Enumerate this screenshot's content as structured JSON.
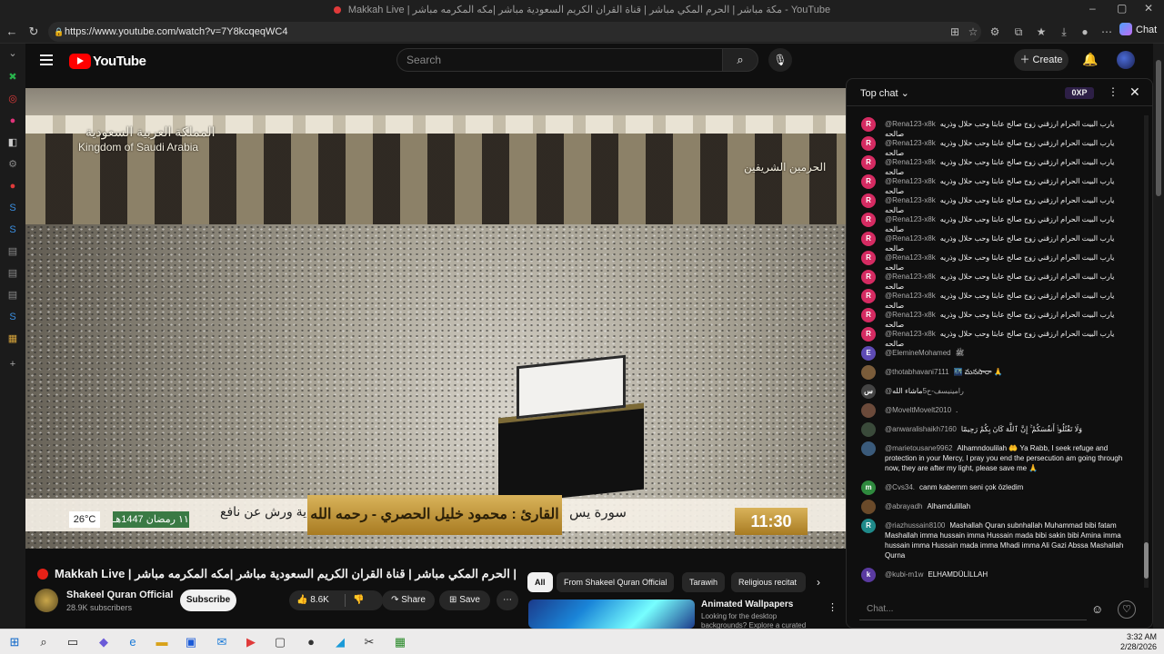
{
  "browser": {
    "window_title": "Makkah Live | مكة مباشر | الحرم المكي مباشر | قناة القران الكريم السعودية مباشر |مكه المكرمه مباشر - YouTube",
    "url": "https://www.youtube.com/watch?v=7Y8kcqeqWC4",
    "chat_label": "Chat"
  },
  "header": {
    "logo_text": "YouTube",
    "search_placeholder": "Search",
    "create_label": "Create"
  },
  "video": {
    "watermark_ar": "المملكة العربية السعودية",
    "watermark_en": "Kingdom of Saudi Arabia",
    "watermark_right": "الحرمين الشريفين",
    "temperature": "26°C",
    "hijri_date": "١١ رمضان 1447هـ",
    "riwaya": "رواية ورش عن نافع",
    "reciter": "القارئ : محمود خليل الحصري - رحمه الله",
    "surah": "سورة يس",
    "clock": "11:30"
  },
  "below": {
    "title": "Makkah Live | مكة مباشر | الحرم المكي مباشر | قناة القران الكريم السعودية مباشر |مكه المكرمه مباشر",
    "channel_name": "Shakeel Quran Official",
    "subscribers": "28.9K subscribers",
    "subscribe_label": "Subscribe",
    "likes": "8.6K",
    "share_label": "Share",
    "save_label": "Save",
    "chips": [
      "All",
      "From Shakeel Quran Official",
      "Tarawih",
      "Religious recitat"
    ],
    "rec_title": "Animated Wallpapers",
    "rec_sub": "Looking for the desktop backgrounds? Explore a curated"
  },
  "chat": {
    "header": "Top chat",
    "xp": "0XP",
    "input_placeholder": "Chat...",
    "messages": [
      {
        "initial": "R",
        "author": "@Rena123-x8k",
        "text": "يارب البيت الحرام ارزقني زوج صالح عابثا وحب حلال وذريه صالحه",
        "color": "#d52b62"
      },
      {
        "initial": "R",
        "author": "@Rena123-x8k",
        "text": "يارب البيت الحرام ارزقني زوج صالح عابثا وحب حلال وذريه صالحه",
        "color": "#d52b62"
      },
      {
        "initial": "R",
        "author": "@Rena123-x8k",
        "text": "يارب البيت الحرام ارزقني زوج صالح عابثا وحب حلال وذريه صالحه",
        "color": "#d52b62"
      },
      {
        "initial": "R",
        "author": "@Rena123-x8k",
        "text": "يارب البيت الحرام ارزقني زوج صالح عابثا وحب حلال وذريه صالحه",
        "color": "#d52b62"
      },
      {
        "initial": "R",
        "author": "@Rena123-x8k",
        "text": "يارب البيت الحرام ارزقني زوج صالح عابثا وحب حلال وذريه صالحه",
        "color": "#d52b62"
      },
      {
        "initial": "R",
        "author": "@Rena123-x8k",
        "text": "يارب البيت الحرام ارزقني زوج صالح عابثا وحب حلال وذريه صالحه",
        "color": "#d52b62"
      },
      {
        "initial": "R",
        "author": "@Rena123-x8k",
        "text": "يارب البيت الحرام ارزقني زوج صالح عابثا وحب حلال وذريه صالحه",
        "color": "#d52b62"
      },
      {
        "initial": "R",
        "author": "@Rena123-x8k",
        "text": "يارب البيت الحرام ارزقني زوج صالح عابثا وحب حلال وذريه صالحه",
        "color": "#d52b62"
      },
      {
        "initial": "R",
        "author": "@Rena123-x8k",
        "text": "يارب البيت الحرام ارزقني زوج صالح عابثا وحب حلال وذريه صالحه",
        "color": "#d52b62"
      },
      {
        "initial": "R",
        "author": "@Rena123-x8k",
        "text": "يارب البيت الحرام ارزقني زوج صالح عابثا وحب حلال وذريه صالحه",
        "color": "#d52b62"
      },
      {
        "initial": "R",
        "author": "@Rena123-x8k",
        "text": "يارب البيت الحرام ارزقني زوج صالح عابثا وحب حلال وذريه صالحه",
        "color": "#d52b62"
      },
      {
        "initial": "R",
        "author": "@Rena123-x8k",
        "text": "يارب البيت الحرام ارزقني زوج صالح عابثا وحب حلال وذريه صالحه",
        "color": "#d52b62"
      },
      {
        "initial": "E",
        "author": "@EleminеMohamed",
        "text": "ﷺ",
        "color": "#5e4bb5"
      },
      {
        "initial": "",
        "author": "@thotabhavani7111",
        "text": "🌃 మనసారా 🙏",
        "color": "#7a5c3a"
      },
      {
        "initial": "س",
        "author": "@رامينيسف-ح5",
        "text": "ماشاء الله",
        "color": "#444"
      },
      {
        "initial": "",
        "author": "@MoveltMovelt2010",
        "text": ".",
        "color": "#6b4a3a"
      },
      {
        "initial": "",
        "author": "@anwaralishaikh7160",
        "text": "وَلَا تَقْتُلُوا۟ أَنفُسَكُمْ ۚ إِنَّ ٱللَّهَ كَانَ بِكُمْ رَحِيمًا",
        "color": "#3a4a3a"
      },
      {
        "initial": "",
        "author": "@marietousane9962",
        "text": "Alhamndoulilah 🤲 Ya Rabb, I seek refuge and protection in your Mercy, I pray you end the persecution am going through now, they are after my light, please save me 🙏",
        "color": "#3a5a7a"
      },
      {
        "initial": "m",
        "author": "@Cvs34.",
        "text": "canm kabernm seni çok özledim",
        "color": "#2f8a3e"
      },
      {
        "initial": "",
        "author": "@abrayadh",
        "text": "Alhamdulillah",
        "color": "#6a4a2a"
      },
      {
        "initial": "R",
        "author": "@riazhussain8100",
        "text": "Mashallah Quran subnhallah Muhammad bibi fatam Mashallah imma hussain imma Hussain mada bibi sakin bibi Amina imma hussain imma Hussain mada imma Mhadi imma Ali Gazi Abssa Mashallah Qurna",
        "color": "#1f8a8a"
      },
      {
        "initial": "k",
        "author": "@kubi-m1w",
        "text": "ELHAMDÜLİLLAH",
        "color": "#5a3aa0"
      }
    ]
  },
  "taskbar": {
    "time": "3:32 AM",
    "date": "2/28/2026"
  }
}
